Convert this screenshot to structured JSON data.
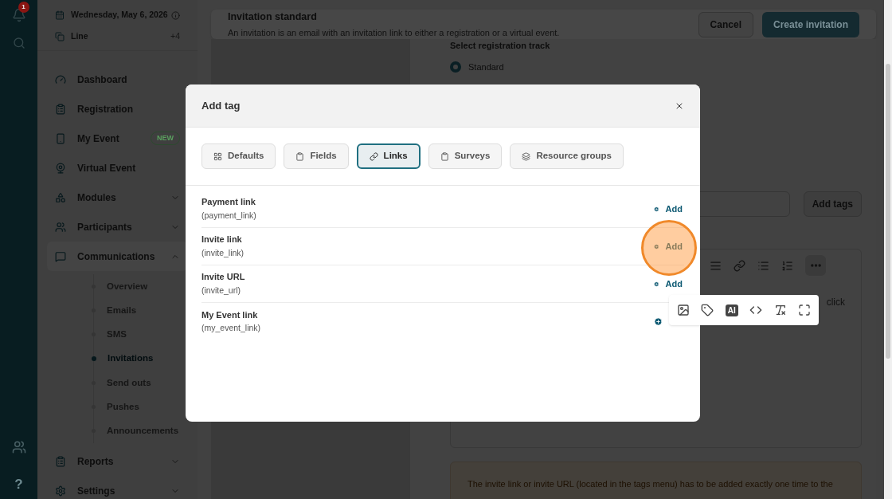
{
  "rail": {
    "notification_count": "1",
    "help_label": "?"
  },
  "sidebar": {
    "date": "Wednesday, May 6, 2026",
    "line": {
      "label": "Line",
      "count": "+4"
    },
    "items": [
      {
        "label": "Dashboard",
        "kind": "link"
      },
      {
        "label": "Registration",
        "kind": "link"
      },
      {
        "label": "My Event",
        "kind": "link",
        "badge": "NEW"
      },
      {
        "label": "Virtual Event",
        "kind": "link"
      },
      {
        "label": "Modules",
        "kind": "group",
        "expanded": false
      },
      {
        "label": "Participants",
        "kind": "group",
        "expanded": false
      },
      {
        "label": "Communications",
        "kind": "group",
        "expanded": true,
        "children": [
          {
            "label": "Overview",
            "selected": false
          },
          {
            "label": "Emails",
            "selected": false
          },
          {
            "label": "SMS",
            "selected": false
          },
          {
            "label": "Invitations",
            "selected": true
          },
          {
            "label": "Send outs",
            "selected": false
          },
          {
            "label": "Pushes",
            "selected": false
          },
          {
            "label": "Announcements",
            "selected": false
          }
        ]
      },
      {
        "label": "Reports",
        "kind": "group",
        "expanded": false
      },
      {
        "label": "Settings",
        "kind": "group",
        "expanded": false
      }
    ]
  },
  "header": {
    "title": "Invitation standard",
    "description": "An invitation is an email with an invitation link to either a registration or a virtual event.",
    "buttons": [
      "Cancel",
      "Create invitation"
    ]
  },
  "form": {
    "track_label": "Select registration track",
    "track_options": [
      {
        "label": "Standard",
        "selected": true
      }
    ],
    "add_tags_button": "Add tags",
    "editor_text": "click",
    "warning": "The invite link or invite URL (located in the tags menu) has to be added exactly one time to the"
  },
  "editor_popup": {
    "ai_label": "AI"
  },
  "modal": {
    "title": "Add tag",
    "tabs": [
      {
        "label": "Defaults",
        "selected": false
      },
      {
        "label": "Fields",
        "selected": false
      },
      {
        "label": "Links",
        "selected": true
      },
      {
        "label": "Surveys",
        "selected": false
      },
      {
        "label": "Resource groups",
        "selected": false
      }
    ],
    "rows": [
      {
        "name": "Payment link",
        "tag": "(payment_link)",
        "add_label": "Add",
        "highlighted": false
      },
      {
        "name": "Invite link",
        "tag": "(invite_link)",
        "add_label": "Add",
        "highlighted": true
      },
      {
        "name": "Invite URL",
        "tag": "(invite_url)",
        "add_label": "Add",
        "highlighted": false
      },
      {
        "name": "My Event link",
        "tag": "(my_event_link)",
        "highlighted": false
      }
    ]
  }
}
